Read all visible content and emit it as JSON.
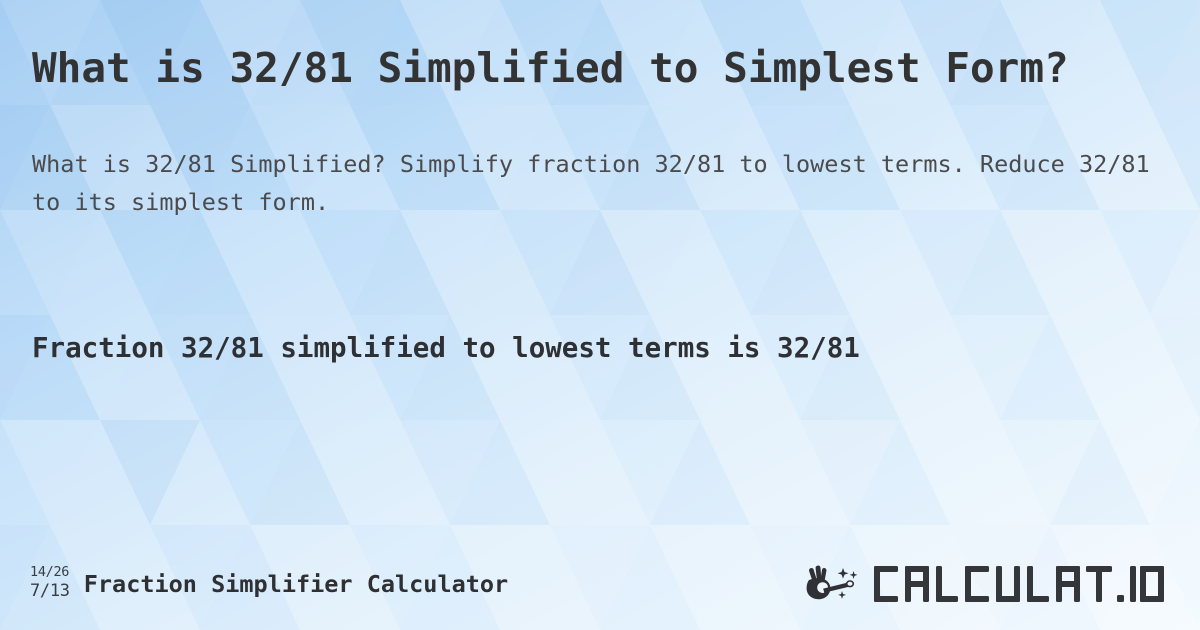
{
  "page": {
    "title": "What is 32/81 Simplified to Simplest Form?",
    "subtitle": "What is 32/81 Simplified? Simplify fraction 32/81 to lowest terms. Reduce 32/81 to its simplest form.",
    "result": "Fraction 32/81 simplified to lowest terms is 32/81"
  },
  "footer": {
    "badge": {
      "numerator_example": "14/26",
      "denominator_example": "7/13"
    },
    "title": "Fraction Simplifier Calculator",
    "brand": {
      "name": "CALCULAT.IO",
      "wand_icon": "magic-wand-hand-icon"
    }
  },
  "colors": {
    "title_text": "#333334",
    "subtitle_text": "#4b4b4d",
    "result_text": "#2f3033",
    "brand_text": "#34363a",
    "background_light": "#f2f8fe",
    "background_mid": "#bcdcf8",
    "background_deep": "#a8cef3"
  }
}
